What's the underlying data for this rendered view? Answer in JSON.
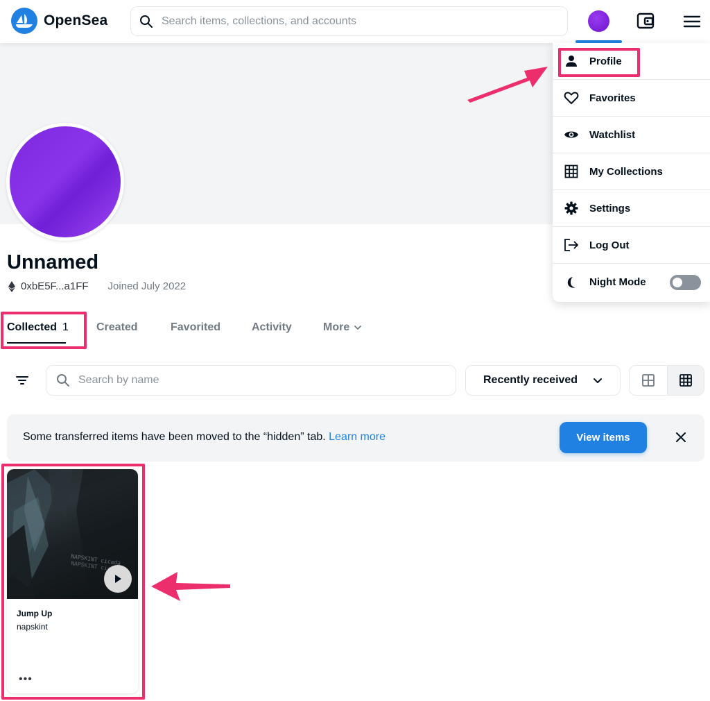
{
  "header": {
    "brand": "OpenSea",
    "search_placeholder": "Search items, collections, and accounts"
  },
  "profile": {
    "name": "Unnamed",
    "address": "0xbE5F...a1FF",
    "joined": "Joined July 2022"
  },
  "tabs": [
    {
      "label": "Collected",
      "count": "1",
      "active": true
    },
    {
      "label": "Created"
    },
    {
      "label": "Favorited"
    },
    {
      "label": "Activity"
    },
    {
      "label": "More"
    }
  ],
  "filters": {
    "search_placeholder": "Search by name",
    "sort_label": "Recently received"
  },
  "notice": {
    "text": "Some transferred items have been moved to the “hidden” tab. ",
    "link": "Learn more",
    "button": "View items"
  },
  "items": [
    {
      "title": "Jump Up",
      "artist": "napskint",
      "more": "•••"
    }
  ],
  "dropdown": {
    "items": [
      {
        "label": "Profile",
        "icon": "person-icon"
      },
      {
        "label": "Favorites",
        "icon": "heart-icon"
      },
      {
        "label": "Watchlist",
        "icon": "eye-icon"
      },
      {
        "label": "My Collections",
        "icon": "grid-icon"
      },
      {
        "label": "Settings",
        "icon": "gear-icon"
      },
      {
        "label": "Log Out",
        "icon": "logout-icon"
      },
      {
        "label": "Night Mode",
        "icon": "moon-icon",
        "toggle": false
      }
    ]
  },
  "colors": {
    "accent": "#2081e2",
    "highlight": "#ec2f6c",
    "avatar": "#7d28e0"
  }
}
